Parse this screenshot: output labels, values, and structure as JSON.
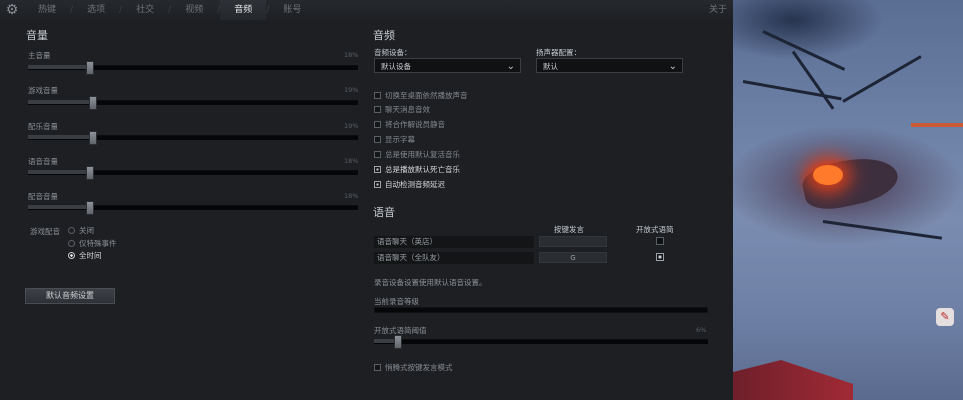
{
  "tabs": [
    {
      "label": "热键",
      "active": false
    },
    {
      "label": "选项",
      "active": false
    },
    {
      "label": "社交",
      "active": false
    },
    {
      "label": "视频",
      "active": false
    },
    {
      "label": "音频",
      "active": true
    },
    {
      "label": "账号",
      "active": false
    }
  ],
  "tab_separator": "/",
  "close_label": "关于",
  "volume": {
    "title": "音量",
    "sliders": [
      {
        "label": "主音量",
        "percent_label": "18%",
        "value": 18
      },
      {
        "label": "游戏音量",
        "percent_label": "19%",
        "value": 19
      },
      {
        "label": "配乐音量",
        "percent_label": "19%",
        "value": 19
      },
      {
        "label": "语音音量",
        "percent_label": "18%",
        "value": 18
      },
      {
        "label": "配音音量",
        "percent_label": "18%",
        "value": 18
      }
    ],
    "announcer": {
      "label": "游戏配音",
      "options": [
        {
          "label": "关闭",
          "selected": false
        },
        {
          "label": "仅特殊事件",
          "selected": false
        },
        {
          "label": "全时间",
          "selected": true
        }
      ]
    },
    "reset_button": "默认音频设置"
  },
  "audio": {
    "title": "音频",
    "device_label": "音频设备：",
    "device_value": "默认设备",
    "speaker_label": "扬声器配置：",
    "speaker_value": "默认",
    "checkboxes": [
      {
        "label": "切换至桌面依然播放声音",
        "checked": false
      },
      {
        "label": "聊天消息音效",
        "checked": false
      },
      {
        "label": "将合作解说员静音",
        "checked": false
      },
      {
        "label": "显示字幕",
        "checked": false
      },
      {
        "label": "总是使用默认复活音乐",
        "checked": false
      },
      {
        "label": "总是播放默认死亡音乐",
        "checked": true
      },
      {
        "label": "自动检测音频延迟",
        "checked": true
      }
    ]
  },
  "voice": {
    "title": "语音",
    "col_push_to_talk": "按键发言",
    "col_open_mic": "开放式语简",
    "rows": [
      {
        "label": "语音聊天（英店）",
        "key": "",
        "open_mic": false
      },
      {
        "label": "语音聊天（全队友）",
        "key": "G",
        "open_mic": true
      }
    ],
    "recording_note": "录音设备设置使用默认语音设置。",
    "record_level_label": "当前录音等级",
    "threshold_label": "开放式语简阈值",
    "threshold_percent_label": "6%",
    "threshold_value": 6,
    "hold_ptt_label": "悄腾式按键发言模式",
    "hold_ptt_checked": false
  },
  "colors": {
    "accent_text": "#e6e8ea",
    "lava": "#ff6a2a"
  }
}
